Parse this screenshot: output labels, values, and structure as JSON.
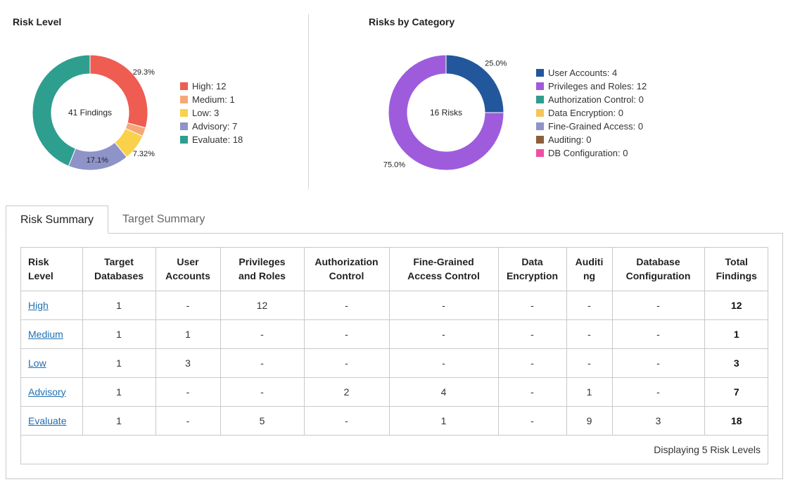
{
  "risk_level_panel": {
    "title": "Risk Level",
    "center_label": "41 Findings",
    "chart_data": {
      "type": "pie",
      "categories": [
        "High",
        "Medium",
        "Low",
        "Advisory",
        "Evaluate"
      ],
      "values": [
        12,
        1,
        3,
        7,
        18
      ],
      "colors": [
        "#ef5c52",
        "#f5a877",
        "#f9d14a",
        "#8e93c8",
        "#2e9e8f"
      ],
      "slice_labels": [
        "29.3%",
        "",
        "7.32%",
        "17.1%",
        ""
      ],
      "legend": [
        "High: 12",
        "Medium: 1",
        "Low: 3",
        "Advisory: 7",
        "Evaluate: 18"
      ],
      "legend_placement": "right"
    }
  },
  "category_panel": {
    "title": "Risks by Category",
    "center_label": "16 Risks",
    "chart_data": {
      "type": "pie",
      "categories": [
        "User Accounts",
        "Privileges and Roles",
        "Authorization Control",
        "Data Encryption",
        "Fine-Grained Access",
        "Auditing",
        "DB Configuration"
      ],
      "values": [
        4,
        12,
        0,
        0,
        0,
        0,
        0
      ],
      "colors": [
        "#23579c",
        "#9e5cdd",
        "#2e9e8f",
        "#f6c55a",
        "#8e93c8",
        "#8b5e3c",
        "#ee4fa3"
      ],
      "slice_labels": [
        "25.0%",
        "75.0%",
        "",
        "",
        "",
        "",
        ""
      ],
      "legend": [
        "User Accounts: 4",
        "Privileges and Roles: 12",
        "Authorization Control: 0",
        "Data Encryption: 0",
        "Fine-Grained Access: 0",
        "Auditing: 0",
        "DB Configuration: 0"
      ],
      "legend_placement": "right"
    }
  },
  "tabs": [
    {
      "label": "Risk Summary",
      "active": true
    },
    {
      "label": "Target Summary",
      "active": false
    }
  ],
  "table": {
    "headers": [
      [
        "Risk",
        "Level"
      ],
      [
        "Target",
        "Databases"
      ],
      [
        "User",
        "Accounts"
      ],
      [
        "Privileges",
        "and Roles"
      ],
      [
        "Authorization",
        "Control"
      ],
      [
        "Fine-Grained",
        "Access Control"
      ],
      [
        "Data",
        "Encryption"
      ],
      [
        "Auditi",
        "ng"
      ],
      [
        "Database",
        "Configuration"
      ],
      [
        "Total",
        "Findings"
      ]
    ],
    "rows": [
      [
        "High",
        "1",
        "-",
        "12",
        "-",
        "-",
        "-",
        "-",
        "-",
        "12"
      ],
      [
        "Medium",
        "1",
        "1",
        "-",
        "-",
        "-",
        "-",
        "-",
        "-",
        "1"
      ],
      [
        "Low",
        "1",
        "3",
        "-",
        "-",
        "-",
        "-",
        "-",
        "-",
        "3"
      ],
      [
        "Advisory",
        "1",
        "-",
        "-",
        "2",
        "4",
        "-",
        "1",
        "-",
        "7"
      ],
      [
        "Evaluate",
        "1",
        "-",
        "5",
        "-",
        "1",
        "-",
        "9",
        "3",
        "18"
      ]
    ],
    "footer": "Displaying 5 Risk Levels"
  }
}
